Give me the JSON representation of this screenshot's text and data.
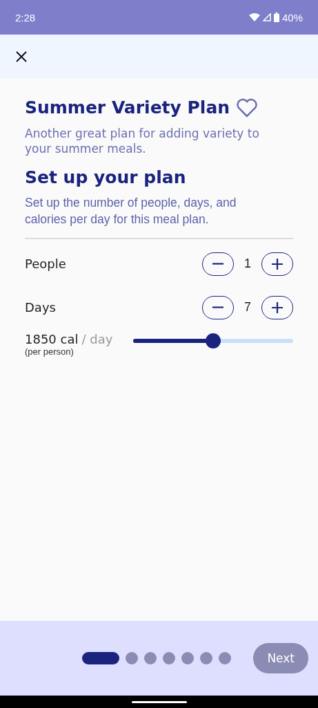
{
  "status_bar": {
    "time": "2:28",
    "battery": "40%"
  },
  "plan": {
    "title": "Summer Variety Plan",
    "favorite": false,
    "description": "Another great plan for adding variety to your summer meals."
  },
  "setup": {
    "heading": "Set up your plan",
    "description": "Set up the number of people, days, and calories per day for this meal plan."
  },
  "counters": [
    {
      "label": "People",
      "value": "1"
    },
    {
      "label": "Days",
      "value": "7"
    }
  ],
  "calories": {
    "amount": "1850 cal",
    "unit": "/ day",
    "note": "(per person)",
    "level": 0.5
  },
  "pager": [
    {
      "selected": true
    },
    {
      "selected": false
    },
    {
      "selected": false
    },
    {
      "selected": false
    },
    {
      "selected": false
    },
    {
      "selected": false
    },
    {
      "selected": false
    }
  ],
  "next_button": {
    "label": "Next",
    "disabled": true
  }
}
